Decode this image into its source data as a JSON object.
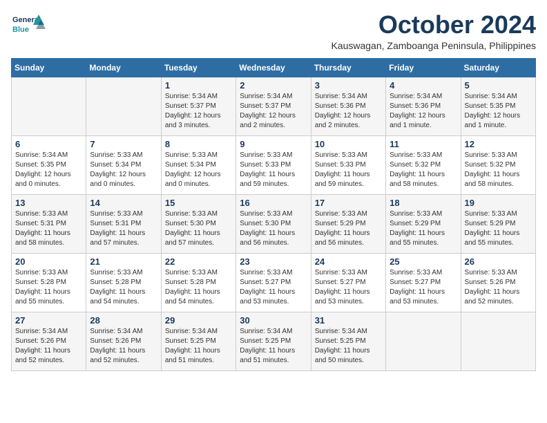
{
  "logo": {
    "text_general": "General",
    "text_blue": "Blue"
  },
  "header": {
    "month": "October 2024",
    "location": "Kauswagan, Zamboanga Peninsula, Philippines"
  },
  "columns": [
    "Sunday",
    "Monday",
    "Tuesday",
    "Wednesday",
    "Thursday",
    "Friday",
    "Saturday"
  ],
  "weeks": [
    [
      {
        "day": "",
        "sunrise": "",
        "sunset": "",
        "daylight": ""
      },
      {
        "day": "",
        "sunrise": "",
        "sunset": "",
        "daylight": ""
      },
      {
        "day": "1",
        "sunrise": "Sunrise: 5:34 AM",
        "sunset": "Sunset: 5:37 PM",
        "daylight": "Daylight: 12 hours and 3 minutes."
      },
      {
        "day": "2",
        "sunrise": "Sunrise: 5:34 AM",
        "sunset": "Sunset: 5:37 PM",
        "daylight": "Daylight: 12 hours and 2 minutes."
      },
      {
        "day": "3",
        "sunrise": "Sunrise: 5:34 AM",
        "sunset": "Sunset: 5:36 PM",
        "daylight": "Daylight: 12 hours and 2 minutes."
      },
      {
        "day": "4",
        "sunrise": "Sunrise: 5:34 AM",
        "sunset": "Sunset: 5:36 PM",
        "daylight": "Daylight: 12 hours and 1 minute."
      },
      {
        "day": "5",
        "sunrise": "Sunrise: 5:34 AM",
        "sunset": "Sunset: 5:35 PM",
        "daylight": "Daylight: 12 hours and 1 minute."
      }
    ],
    [
      {
        "day": "6",
        "sunrise": "Sunrise: 5:34 AM",
        "sunset": "Sunset: 5:35 PM",
        "daylight": "Daylight: 12 hours and 0 minutes."
      },
      {
        "day": "7",
        "sunrise": "Sunrise: 5:33 AM",
        "sunset": "Sunset: 5:34 PM",
        "daylight": "Daylight: 12 hours and 0 minutes."
      },
      {
        "day": "8",
        "sunrise": "Sunrise: 5:33 AM",
        "sunset": "Sunset: 5:34 PM",
        "daylight": "Daylight: 12 hours and 0 minutes."
      },
      {
        "day": "9",
        "sunrise": "Sunrise: 5:33 AM",
        "sunset": "Sunset: 5:33 PM",
        "daylight": "Daylight: 11 hours and 59 minutes."
      },
      {
        "day": "10",
        "sunrise": "Sunrise: 5:33 AM",
        "sunset": "Sunset: 5:33 PM",
        "daylight": "Daylight: 11 hours and 59 minutes."
      },
      {
        "day": "11",
        "sunrise": "Sunrise: 5:33 AM",
        "sunset": "Sunset: 5:32 PM",
        "daylight": "Daylight: 11 hours and 58 minutes."
      },
      {
        "day": "12",
        "sunrise": "Sunrise: 5:33 AM",
        "sunset": "Sunset: 5:32 PM",
        "daylight": "Daylight: 11 hours and 58 minutes."
      }
    ],
    [
      {
        "day": "13",
        "sunrise": "Sunrise: 5:33 AM",
        "sunset": "Sunset: 5:31 PM",
        "daylight": "Daylight: 11 hours and 58 minutes."
      },
      {
        "day": "14",
        "sunrise": "Sunrise: 5:33 AM",
        "sunset": "Sunset: 5:31 PM",
        "daylight": "Daylight: 11 hours and 57 minutes."
      },
      {
        "day": "15",
        "sunrise": "Sunrise: 5:33 AM",
        "sunset": "Sunset: 5:30 PM",
        "daylight": "Daylight: 11 hours and 57 minutes."
      },
      {
        "day": "16",
        "sunrise": "Sunrise: 5:33 AM",
        "sunset": "Sunset: 5:30 PM",
        "daylight": "Daylight: 11 hours and 56 minutes."
      },
      {
        "day": "17",
        "sunrise": "Sunrise: 5:33 AM",
        "sunset": "Sunset: 5:29 PM",
        "daylight": "Daylight: 11 hours and 56 minutes."
      },
      {
        "day": "18",
        "sunrise": "Sunrise: 5:33 AM",
        "sunset": "Sunset: 5:29 PM",
        "daylight": "Daylight: 11 hours and 55 minutes."
      },
      {
        "day": "19",
        "sunrise": "Sunrise: 5:33 AM",
        "sunset": "Sunset: 5:29 PM",
        "daylight": "Daylight: 11 hours and 55 minutes."
      }
    ],
    [
      {
        "day": "20",
        "sunrise": "Sunrise: 5:33 AM",
        "sunset": "Sunset: 5:28 PM",
        "daylight": "Daylight: 11 hours and 55 minutes."
      },
      {
        "day": "21",
        "sunrise": "Sunrise: 5:33 AM",
        "sunset": "Sunset: 5:28 PM",
        "daylight": "Daylight: 11 hours and 54 minutes."
      },
      {
        "day": "22",
        "sunrise": "Sunrise: 5:33 AM",
        "sunset": "Sunset: 5:28 PM",
        "daylight": "Daylight: 11 hours and 54 minutes."
      },
      {
        "day": "23",
        "sunrise": "Sunrise: 5:33 AM",
        "sunset": "Sunset: 5:27 PM",
        "daylight": "Daylight: 11 hours and 53 minutes."
      },
      {
        "day": "24",
        "sunrise": "Sunrise: 5:33 AM",
        "sunset": "Sunset: 5:27 PM",
        "daylight": "Daylight: 11 hours and 53 minutes."
      },
      {
        "day": "25",
        "sunrise": "Sunrise: 5:33 AM",
        "sunset": "Sunset: 5:27 PM",
        "daylight": "Daylight: 11 hours and 53 minutes."
      },
      {
        "day": "26",
        "sunrise": "Sunrise: 5:33 AM",
        "sunset": "Sunset: 5:26 PM",
        "daylight": "Daylight: 11 hours and 52 minutes."
      }
    ],
    [
      {
        "day": "27",
        "sunrise": "Sunrise: 5:34 AM",
        "sunset": "Sunset: 5:26 PM",
        "daylight": "Daylight: 11 hours and 52 minutes."
      },
      {
        "day": "28",
        "sunrise": "Sunrise: 5:34 AM",
        "sunset": "Sunset: 5:26 PM",
        "daylight": "Daylight: 11 hours and 52 minutes."
      },
      {
        "day": "29",
        "sunrise": "Sunrise: 5:34 AM",
        "sunset": "Sunset: 5:25 PM",
        "daylight": "Daylight: 11 hours and 51 minutes."
      },
      {
        "day": "30",
        "sunrise": "Sunrise: 5:34 AM",
        "sunset": "Sunset: 5:25 PM",
        "daylight": "Daylight: 11 hours and 51 minutes."
      },
      {
        "day": "31",
        "sunrise": "Sunrise: 5:34 AM",
        "sunset": "Sunset: 5:25 PM",
        "daylight": "Daylight: 11 hours and 50 minutes."
      },
      {
        "day": "",
        "sunrise": "",
        "sunset": "",
        "daylight": ""
      },
      {
        "day": "",
        "sunrise": "",
        "sunset": "",
        "daylight": ""
      }
    ]
  ]
}
